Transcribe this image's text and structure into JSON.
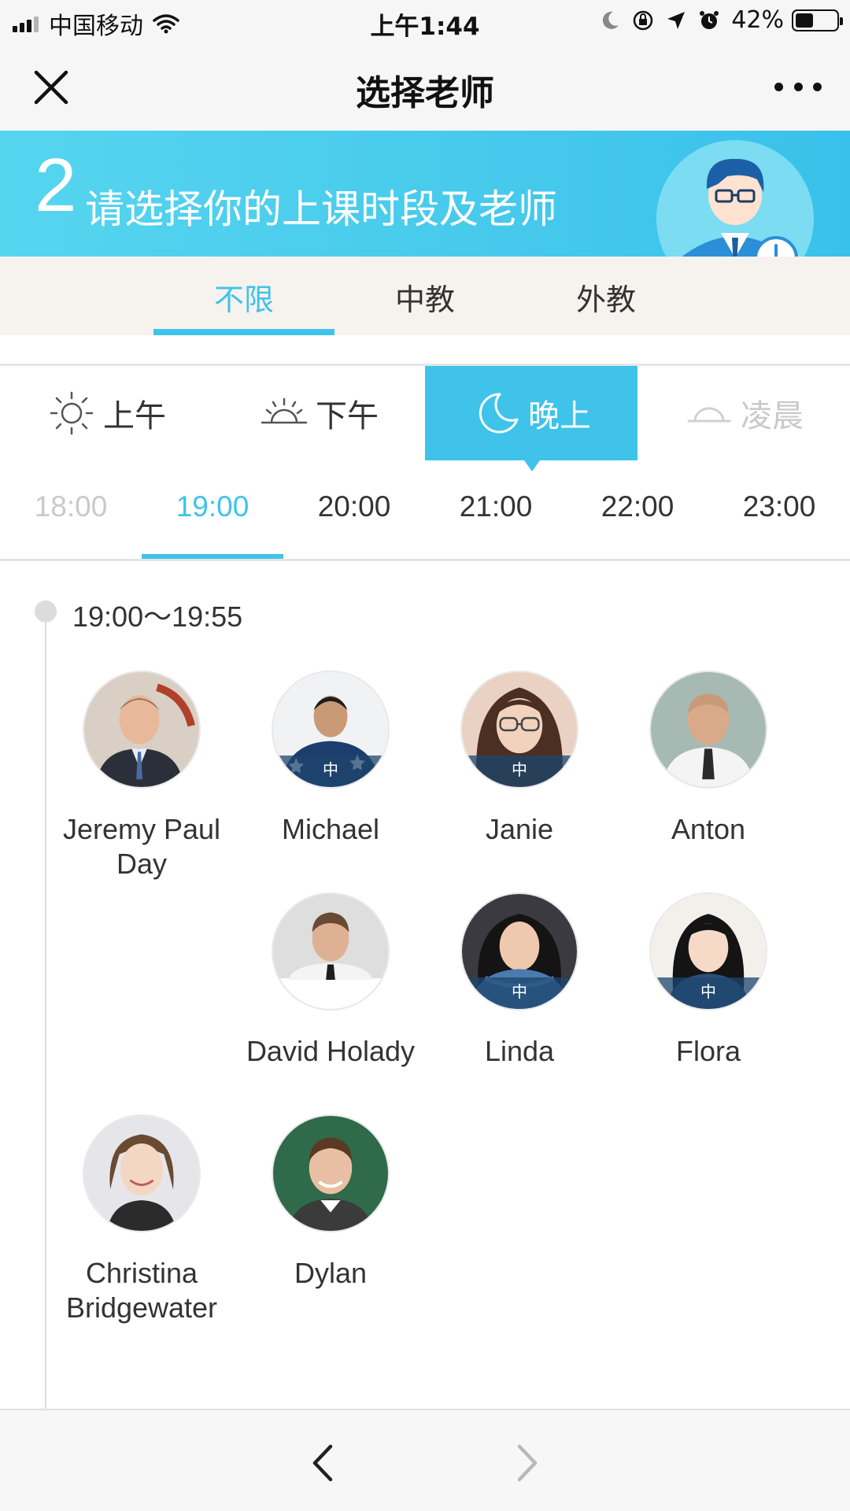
{
  "status_bar": {
    "carrier": "中国移动",
    "time": "上午1:44",
    "battery": "42%"
  },
  "nav": {
    "title": "选择老师"
  },
  "banner": {
    "step": "2",
    "text": "请选择你的上课时段及老师"
  },
  "teacher_type_tabs": [
    {
      "label": "不限",
      "active": true
    },
    {
      "label": "中教",
      "active": false
    },
    {
      "label": "外教",
      "active": false
    }
  ],
  "period_tabs": [
    {
      "label": "上午",
      "icon": "sun-icon"
    },
    {
      "label": "下午",
      "icon": "sunset-icon"
    },
    {
      "label": "晚上",
      "icon": "moon-icon",
      "active": true
    },
    {
      "label": "凌晨",
      "icon": "dawn-icon",
      "disabled": true
    }
  ],
  "hour_tabs": [
    {
      "label": "18:00",
      "disabled": true
    },
    {
      "label": "19:00",
      "active": true
    },
    {
      "label": "20:00"
    },
    {
      "label": "21:00"
    },
    {
      "label": "22:00"
    },
    {
      "label": "23:00"
    }
  ],
  "slot": {
    "time_range": "19:00～19:55"
  },
  "teachers": [
    {
      "name": "Jeremy Paul Day",
      "badge": ""
    },
    {
      "name": "Michael",
      "badge": "中"
    },
    {
      "name": "Janie",
      "badge": "中"
    },
    {
      "name": "Anton",
      "badge": ""
    },
    {
      "name": "David Holady",
      "badge": ""
    },
    {
      "name": "Linda",
      "badge": "中"
    },
    {
      "name": "Flora",
      "badge": "中"
    },
    {
      "name": "Christina Bridgewater",
      "badge": ""
    },
    {
      "name": "Dylan",
      "badge": ""
    }
  ],
  "colors": {
    "accent": "#3fc3ea",
    "tab_bg": "#f6f3ee"
  }
}
